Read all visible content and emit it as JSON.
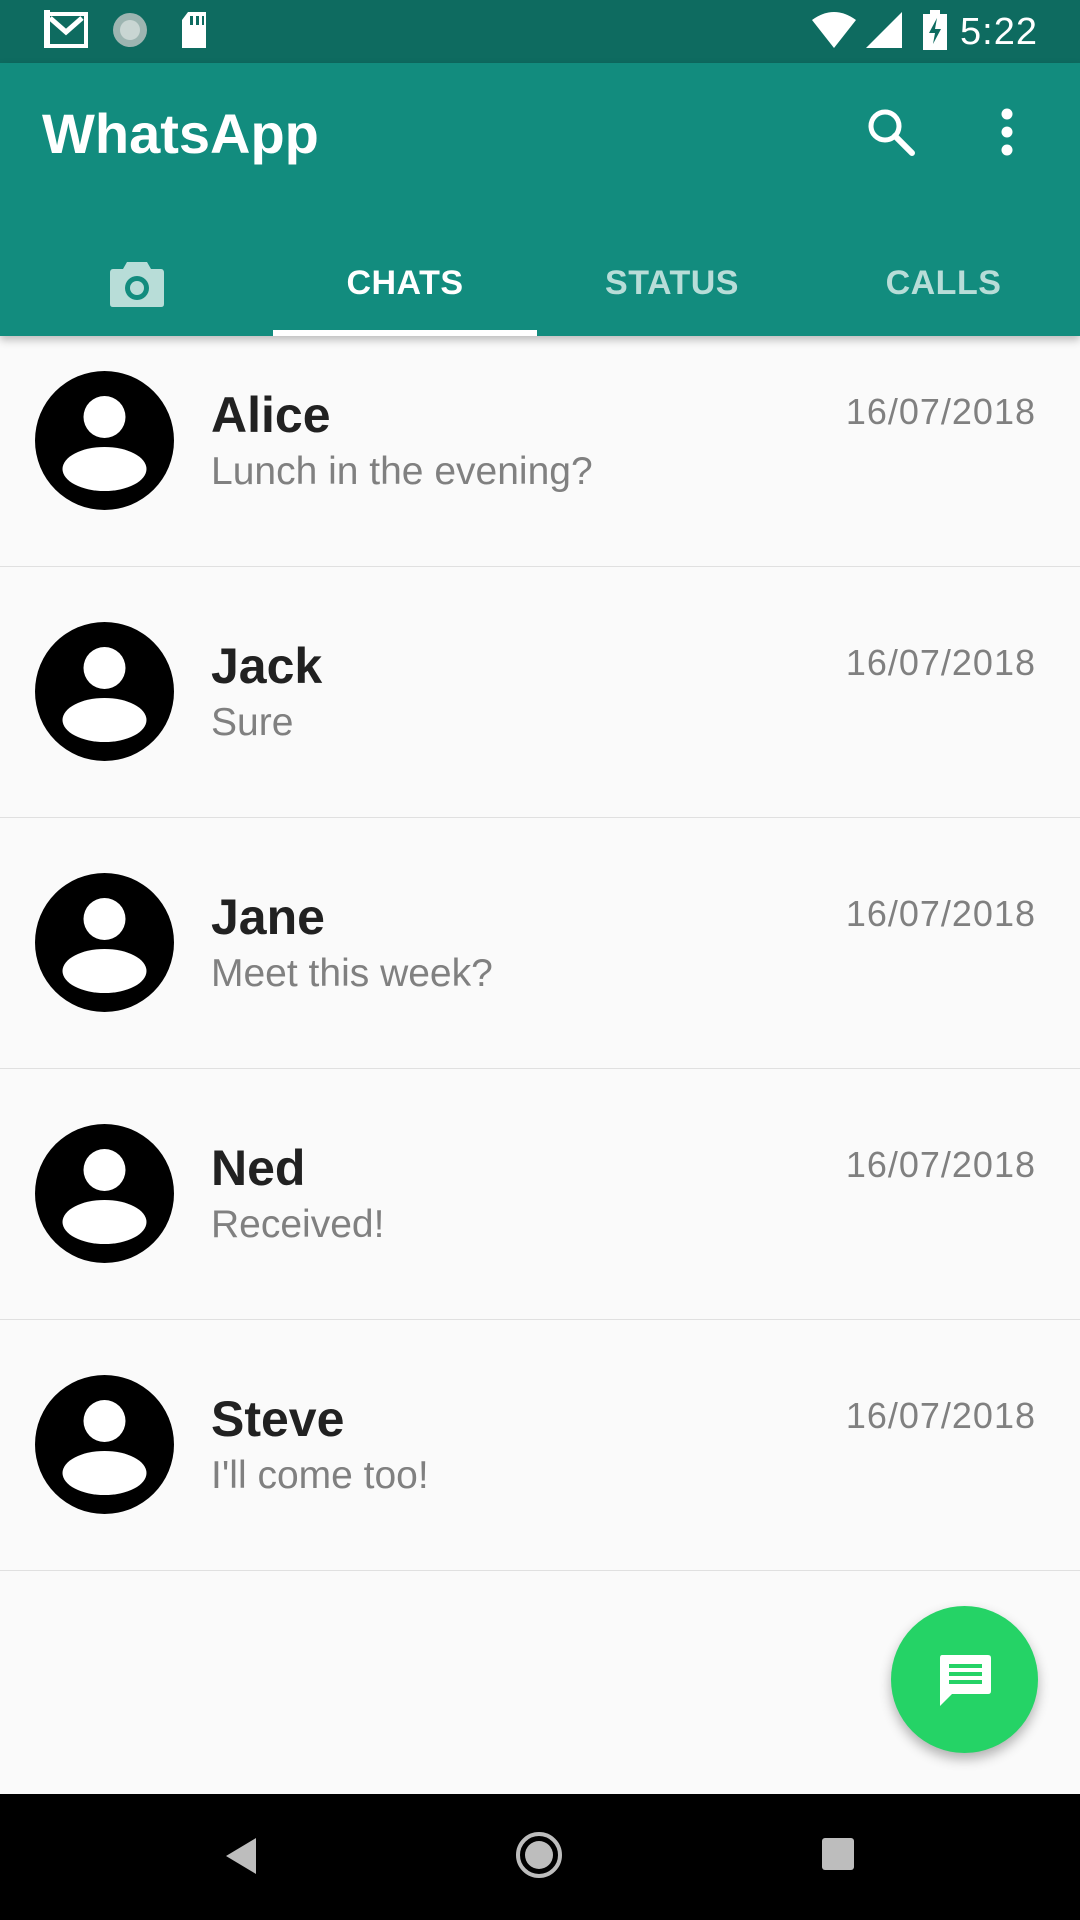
{
  "status_bar": {
    "time": "5:22",
    "icons": [
      "gmail-icon",
      "sync-icon",
      "sd-card-icon",
      "wifi-icon",
      "cell-signal-icon",
      "battery-charging-icon"
    ]
  },
  "app_bar": {
    "title": "WhatsApp",
    "actions": [
      "search-icon",
      "more-vert-icon"
    ],
    "background_color": "#128c7e"
  },
  "tabs": [
    {
      "label": "",
      "icon": "camera-icon",
      "active": false
    },
    {
      "label": "CHATS",
      "active": true
    },
    {
      "label": "STATUS",
      "active": false
    },
    {
      "label": "CALLS",
      "active": false
    }
  ],
  "chats": [
    {
      "name": "Alice",
      "message": "Lunch in the evening?",
      "date": "16/07/2018"
    },
    {
      "name": "Jack",
      "message": "Sure",
      "date": "16/07/2018"
    },
    {
      "name": "Jane",
      "message": "Meet this week?",
      "date": "16/07/2018"
    },
    {
      "name": "Ned",
      "message": "Received!",
      "date": "16/07/2018"
    },
    {
      "name": "Steve",
      "message": "I'll come too!",
      "date": "16/07/2018"
    }
  ],
  "fab": {
    "icon": "chat-icon",
    "color": "#25d366"
  },
  "nav_bar": {
    "buttons": [
      "back-icon",
      "home-icon",
      "recents-icon"
    ]
  }
}
